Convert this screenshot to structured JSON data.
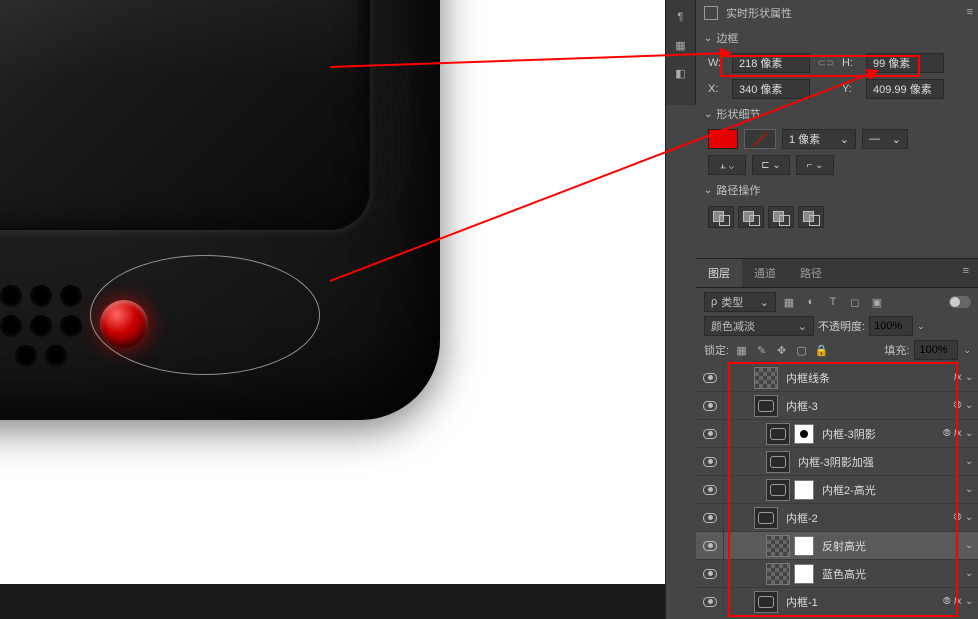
{
  "properties": {
    "title": "实时形状属性",
    "sections": {
      "bounds": "边框",
      "shapeDetail": "形状细节",
      "pathOps": "路径操作"
    },
    "w_label": "W:",
    "w_value": "218 像素",
    "h_label": "H:",
    "h_value": "99 像素",
    "x_label": "X:",
    "x_value": "340 像素",
    "y_label": "Y:",
    "y_value": "409.99 像素",
    "stroke_width": "1 像素"
  },
  "layersPanel": {
    "tabs": {
      "layers": "图层",
      "channels": "通道",
      "paths": "路径"
    },
    "filter_type": "类型",
    "search_icon": "ρ",
    "blend_mode": "颜色减淡",
    "opacity_label": "不透明度:",
    "opacity_value": "100%",
    "lock_label": "锁定:",
    "fill_label": "填充:",
    "fill_value": "100%"
  },
  "layers": [
    {
      "name": "内框线条",
      "fx": true,
      "depth": 2,
      "thumbs": [
        "trans"
      ]
    },
    {
      "name": "内框-3",
      "link": true,
      "depth": 2,
      "thumbs": [
        "shape"
      ]
    },
    {
      "name": "内框-3阴影",
      "link": true,
      "fx": true,
      "depth": 3,
      "thumbs": [
        "shape",
        "maskdot"
      ]
    },
    {
      "name": "内框-3阴影加强",
      "depth": 3,
      "thumbs": [
        "shape"
      ]
    },
    {
      "name": "内框2-高光",
      "depth": 3,
      "thumbs": [
        "shape",
        "mask"
      ]
    },
    {
      "name": "内框-2",
      "link": true,
      "depth": 2,
      "thumbs": [
        "shape"
      ]
    },
    {
      "name": "反射高光",
      "selected": true,
      "depth": 3,
      "thumbs": [
        "trans",
        "mask"
      ]
    },
    {
      "name": "蓝色高光",
      "depth": 3,
      "thumbs": [
        "trans",
        "mask"
      ]
    },
    {
      "name": "内框-1",
      "link": true,
      "fx": true,
      "depth": 2,
      "thumbs": [
        "shape"
      ]
    }
  ]
}
